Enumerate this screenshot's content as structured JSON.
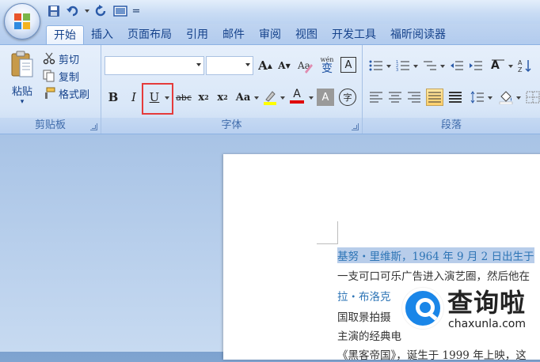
{
  "quick_access": {
    "items": [
      "save-icon",
      "undo-icon",
      "redo-icon",
      "print-preview-icon",
      "customize-icon"
    ],
    "customize_glyph": "="
  },
  "tabs": [
    {
      "label": "开始",
      "active": true
    },
    {
      "label": "插入"
    },
    {
      "label": "页面布局"
    },
    {
      "label": "引用"
    },
    {
      "label": "邮件"
    },
    {
      "label": "审阅"
    },
    {
      "label": "视图"
    },
    {
      "label": "开发工具"
    },
    {
      "label": "福昕阅读器"
    }
  ],
  "clipboard": {
    "paste_label": "粘贴",
    "cut_label": "剪切",
    "copy_label": "复制",
    "format_painter_label": "格式刷",
    "group_label": "剪贴板"
  },
  "font": {
    "group_label": "字体",
    "font_name_value": "",
    "font_size_value": "",
    "grow_label": "A",
    "shrink_label": "A",
    "pinyin_label": "wén",
    "pinyin_char": "变",
    "border_char": "A",
    "bold_label": "B",
    "italic_label": "I",
    "underline_label": "U",
    "strike_label": "abc",
    "subscript_label": "x",
    "superscript_label": "x",
    "change_case_label": "Aa",
    "highlight_color": "#ffff00",
    "font_color_label": "A",
    "font_color": "#e00000",
    "char_shading_label": "A",
    "enclose_char_label": "字"
  },
  "paragraph": {
    "group_label": "段落"
  },
  "document": {
    "lines": [
      "基努・里维斯，1964 年 9 月 2 日出生于",
      "一支可口可乐广告进入演艺圈，然后他在",
      "拉・布洛克",
      "国取景拍摄",
      "主演的经典电",
      "《黑客帝国》，诞生于 1999 年上映，这"
    ]
  },
  "watermark": {
    "title": "查询啦",
    "subtitle": "chaxunla.com"
  }
}
